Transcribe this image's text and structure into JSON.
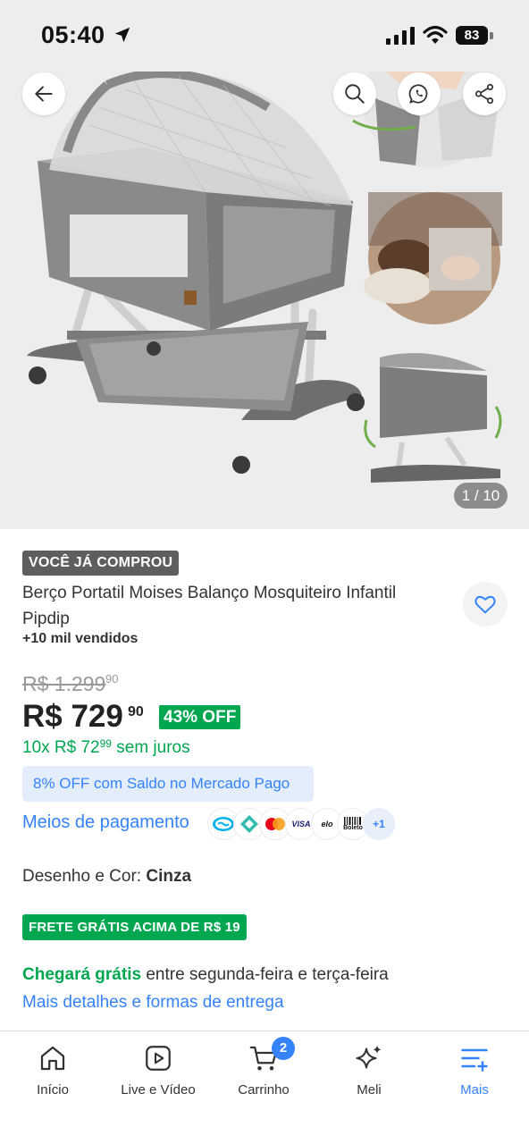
{
  "status_bar": {
    "time": "05:40",
    "battery": "83"
  },
  "gallery": {
    "counter": "1 / 10"
  },
  "product": {
    "tag": "VOCÊ JÁ COMPROU",
    "title": "Berço Portatil Moises Balanço Mosquiteiro Infantil Pipdip",
    "sold": "+10 mil vendidos"
  },
  "pricing": {
    "old_price": "R$ 1.299",
    "old_cents": "90",
    "price": "R$ 729",
    "price_cents": "90",
    "discount": "43% OFF",
    "installments_prefix": "10x R$ 72",
    "installments_cents": "99",
    "installments_suffix": " sem juros",
    "mp_offer": "8% OFF com Saldo no Mercado Pago",
    "payment_link": "Meios de pagamento",
    "payment_more": "+1",
    "visa": "VISA",
    "elo": "elo",
    "boleto": "Boleto"
  },
  "variant": {
    "label": "Desenho e Cor: ",
    "value": "Cinza"
  },
  "shipping": {
    "badge": "FRETE GRÁTIS ACIMA DE R$ 19",
    "arrival_highlight": "Chegará grátis",
    "arrival_rest": " entre segunda-feira e terça-feira",
    "details_link": "Mais detalhes e formas de entrega"
  },
  "nav": {
    "home": "Início",
    "live": "Live e Vídeo",
    "cart": "Carrinho",
    "cart_count": "2",
    "meli": "Meli",
    "more": "Mais"
  },
  "colors": {
    "brand_blue": "#3483fa",
    "success_green": "#00a650"
  }
}
